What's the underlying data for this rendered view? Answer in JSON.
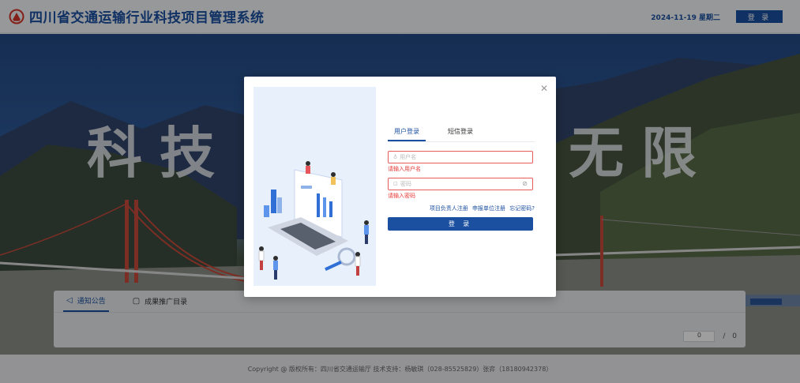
{
  "header": {
    "title": "四川省交通运输行业科技项目管理系统",
    "date": "2024-11-19 星期二",
    "login_label": "登 录"
  },
  "hero": {
    "slogan_left": "科技",
    "slogan_right": "无限"
  },
  "notice": {
    "tabs": [
      {
        "label": "通知公告",
        "icon": "megaphone-icon",
        "active": true
      },
      {
        "label": "成果推广目录",
        "icon": "document-icon",
        "active": false
      }
    ],
    "page_value": "0",
    "page_total": "/ 0"
  },
  "footer": {
    "text": "Copyright @ 版权所有：四川省交通运输厅    技术支持：杨敏琪（028-85525829）张弈（18180942378）"
  },
  "login_modal": {
    "close_icon": "close-icon",
    "tabs": [
      {
        "label": "用户登录",
        "active": true
      },
      {
        "label": "短信登录",
        "active": false
      }
    ],
    "username": {
      "placeholder": "用户名",
      "icon": "user-icon",
      "error": "请输入用户名"
    },
    "password": {
      "placeholder": "密码",
      "icon": "lock-icon",
      "toggle_icon": "eye-hidden-icon",
      "error": "请输入密码"
    },
    "links": [
      "项目负责人注册",
      "申报单位注册",
      "忘记密码?"
    ],
    "submit_label": "登 录"
  },
  "colors": {
    "brand_blue": "#1b4fa0",
    "error_red": "#e53935",
    "logo_red": "#d6352b"
  }
}
